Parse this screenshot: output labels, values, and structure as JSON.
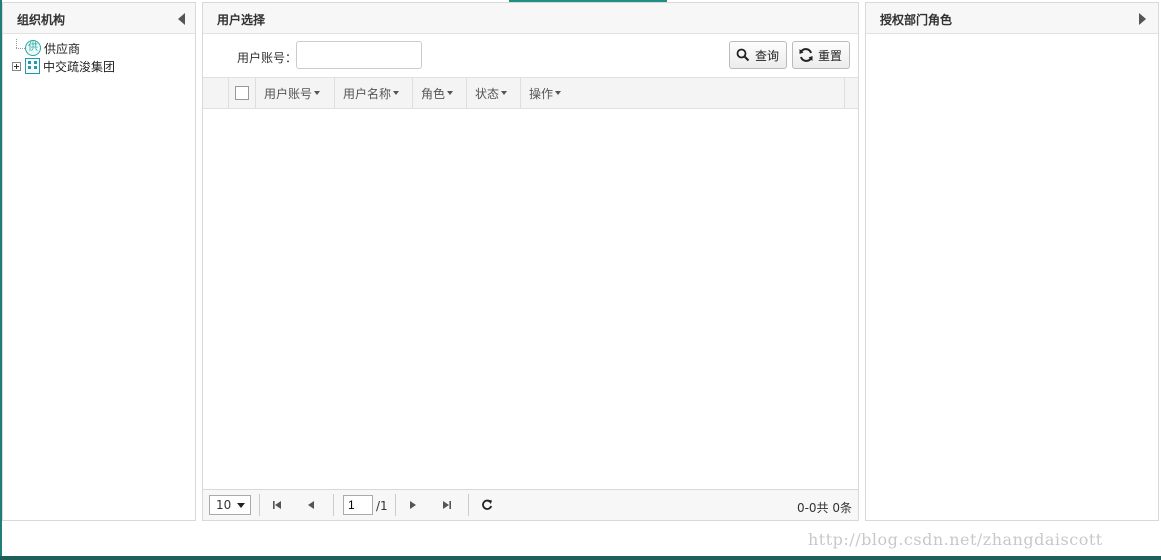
{
  "left_panel": {
    "title": "组织机构",
    "tree": [
      {
        "label": "供应商",
        "icon": "supplier-icon"
      },
      {
        "label": "中交疏浚集团",
        "icon": "organization-icon"
      }
    ]
  },
  "middle_panel": {
    "title": "用户选择",
    "search": {
      "label": "用户账号：",
      "value": "",
      "placeholder": ""
    },
    "buttons": {
      "query": "查询",
      "reset": "重置"
    },
    "columns": [
      "用户账号",
      "用户名称",
      "角色",
      "状态",
      "操作"
    ],
    "rows": [],
    "pager": {
      "page_size": "10",
      "current_page": "1",
      "total_pages": "/1",
      "summary": "0-0共 0条"
    }
  },
  "right_panel": {
    "title": "授权部门角色"
  },
  "watermark": "http://blog.csdn.net/zhangdaiscott",
  "colors": {
    "accent": "#1f7f74",
    "header_bg": "#f7f7f7",
    "border": "#d8d8d8"
  }
}
